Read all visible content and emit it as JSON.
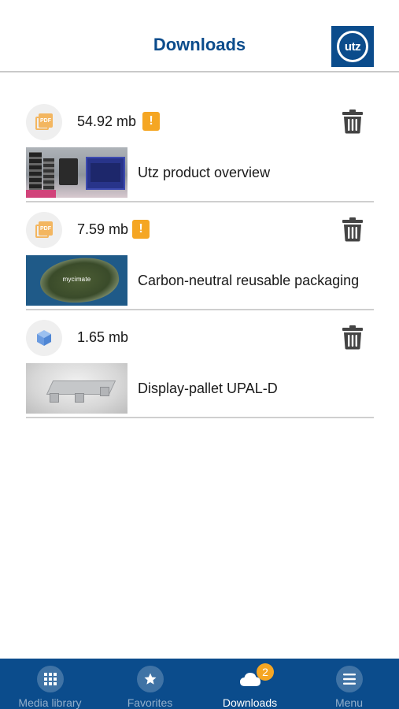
{
  "header": {
    "title": "Downloads",
    "logo_text": "utz"
  },
  "colors": {
    "brand": "#0b4c8c",
    "warning": "#f5a623",
    "pdf_accent": "#f3b660",
    "model_accent": "#6a9be0"
  },
  "downloads": [
    {
      "type_icon": "pdf-icon",
      "type_label": "PDF",
      "size": "54.92 mb",
      "warning": "!",
      "title": "Utz product overview"
    },
    {
      "type_icon": "pdf-icon",
      "type_label": "PDF",
      "size": "7.59 mb",
      "warning": "!",
      "title": "Carbon-neutral reusable packaging",
      "thumbnail_text": "mycimate"
    },
    {
      "type_icon": "cube-icon",
      "size": "1.65 mb",
      "title": "Display-pallet UPAL-D"
    }
  ],
  "tabbar": {
    "tabs": [
      {
        "label": "Media library",
        "icon": "grid-icon"
      },
      {
        "label": "Favorites",
        "icon": "star-icon"
      },
      {
        "label": "Downloads",
        "icon": "cloud-icon",
        "badge": "2",
        "active": true
      },
      {
        "label": "Menu",
        "icon": "menu-icon"
      }
    ]
  }
}
